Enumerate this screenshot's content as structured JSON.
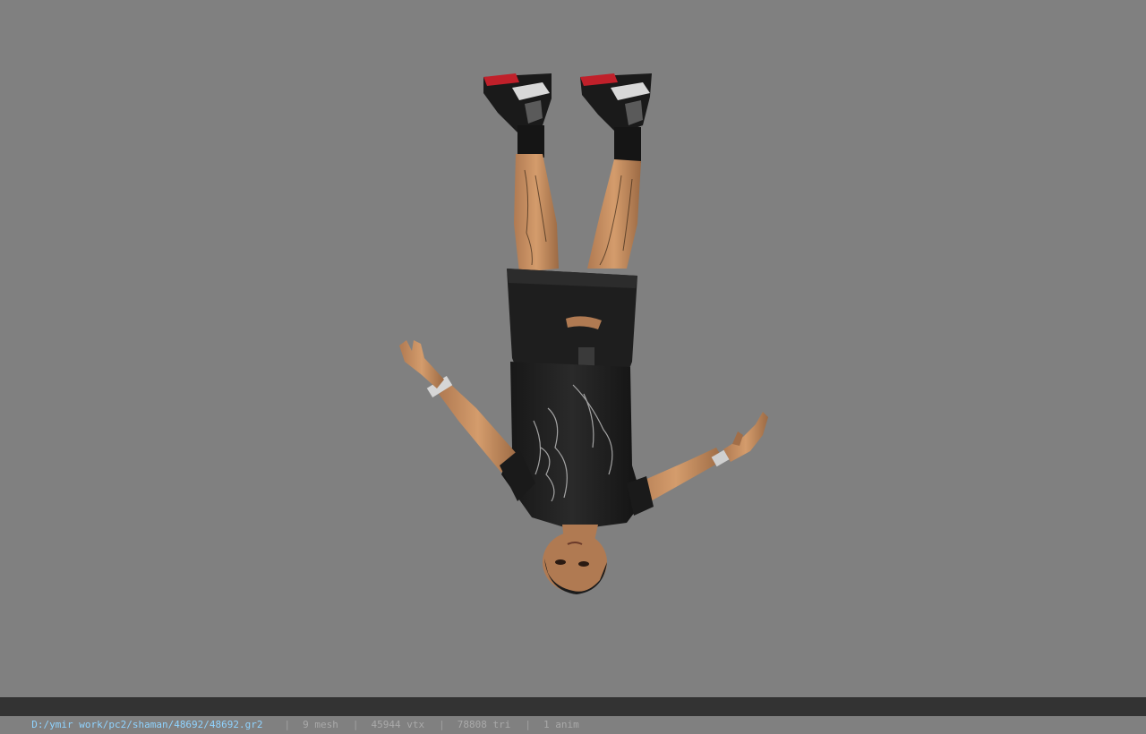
{
  "viewport": {
    "background": "#808080",
    "subject": "3d-character-model"
  },
  "statusbar": {
    "file_path": "D:/ymir work/pc2/shaman/48692/48692.gr2",
    "separator": "|",
    "mesh_count": "9 mesh",
    "vertex_count": "45944 vtx",
    "triangle_count": "78808 tri",
    "anim_count": "1 anim"
  }
}
